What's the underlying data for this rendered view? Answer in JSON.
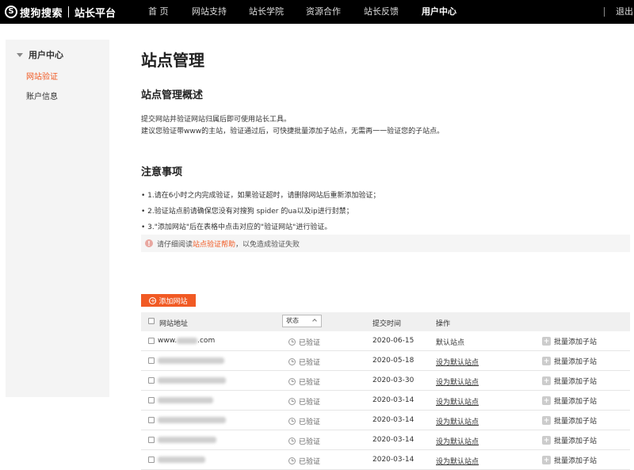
{
  "brand": {
    "logo_letter": "S",
    "name": "搜狗搜索",
    "platform": "站长平台"
  },
  "nav": [
    {
      "label": "首 页"
    },
    {
      "label": "网站支持"
    },
    {
      "label": "站长学院"
    },
    {
      "label": "资源合作"
    },
    {
      "label": "站长反馈"
    },
    {
      "label": "用户中心"
    }
  ],
  "logout": "退出",
  "sidebar": {
    "heading": "用户中心",
    "items": [
      {
        "label": "网站验证"
      },
      {
        "label": "账户信息"
      }
    ]
  },
  "page_title": "站点管理",
  "overview": {
    "title": "站点管理概述",
    "lines": [
      "提交网站并验证网站归属后即可使用站长工具。",
      "建议您验证带www的主站，验证通过后，可快捷批量添加子站点，无需再一一验证您的子站点。"
    ]
  },
  "notes": {
    "title": "注意事项",
    "items": [
      "• 1.请在6小时之内完成验证，如果验证超时，请删除网站后重新添加验证；",
      "• 2.验证站点前请确保您没有对搜狗 spider 的ua以及ip进行封禁；",
      "• 3.\"添加网站\"后在表格中点击对应的\"验证网站\"进行验证。"
    ]
  },
  "tip": {
    "prefix": "请仔细阅读",
    "link": "站点验证帮助",
    "suffix": "，以免造成验证失败"
  },
  "add_button": "添加网站",
  "table": {
    "headers": {
      "url": "网站地址",
      "status_select": "状态",
      "time": "提交时间",
      "op": "操作"
    },
    "rows": [
      {
        "url_prefix": "www.",
        "url_suffix": ".com",
        "status": "已验证",
        "date": "2020-06-15",
        "op": "默认站点",
        "batch": "批量添加子站"
      },
      {
        "status": "已验证",
        "date": "2020-05-18",
        "op": "设为默认站点",
        "batch": "批量添加子站"
      },
      {
        "status": "已验证",
        "date": "2020-03-30",
        "op": "设为默认站点",
        "batch": "批量添加子站"
      },
      {
        "status": "已验证",
        "date": "2020-03-14",
        "op": "设为默认站点",
        "batch": "批量添加子站"
      },
      {
        "status": "已验证",
        "date": "2020-03-14",
        "op": "设为默认站点",
        "batch": "批量添加子站"
      },
      {
        "status": "已验证",
        "date": "2020-03-14",
        "op": "设为默认站点",
        "batch": "批量添加子站"
      },
      {
        "status": "已验证",
        "date": "2020-03-14",
        "op": "设为默认站点",
        "batch": "批量添加子站"
      }
    ]
  },
  "colors": {
    "accent": "#f15a24",
    "topbar": "#000000",
    "sidebar_bg": "#f4f4f4"
  }
}
